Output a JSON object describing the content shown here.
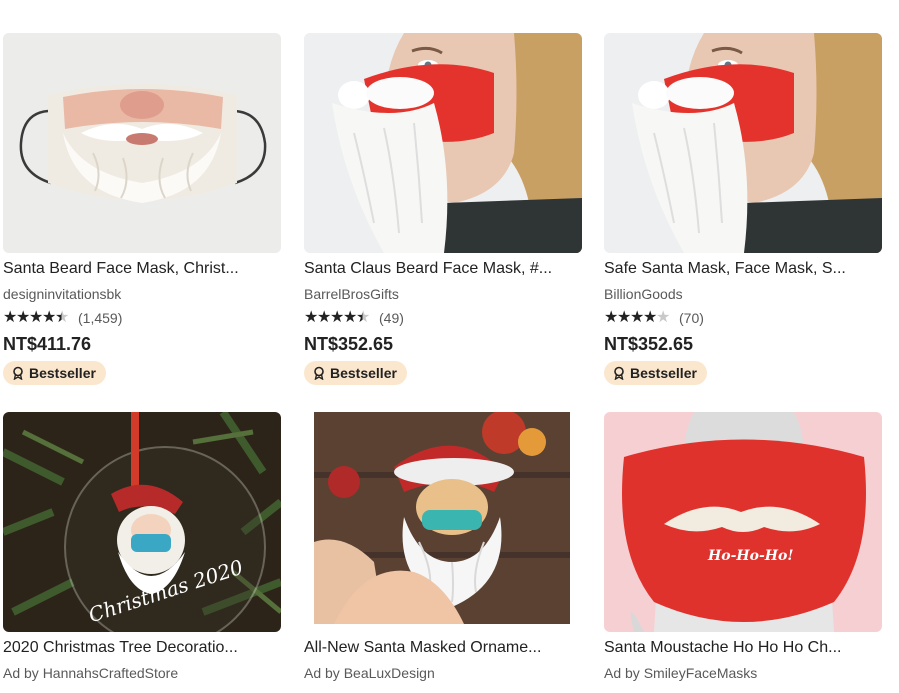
{
  "listings": [
    {
      "title": "Santa Beard Face Mask, Christ...",
      "shop": "designinvitationsbk",
      "stars": [
        1,
        1,
        1,
        1,
        0.5
      ],
      "reviews": "(1,459)",
      "price": "NT$411.76",
      "badge": "Bestseller",
      "image_icon": "santa-beard-mask-image"
    },
    {
      "title": "Santa Claus Beard Face Mask, #...",
      "shop": "BarrelBrosGifts",
      "stars": [
        1,
        1,
        1,
        1,
        0.5
      ],
      "reviews": "(49)",
      "price": "NT$352.65",
      "badge": "Bestseller",
      "image_icon": "red-mask-white-beard-image"
    },
    {
      "title": "Safe Santa Mask, Face Mask, S...",
      "shop": "BillionGoods",
      "stars": [
        1,
        1,
        1,
        1,
        0
      ],
      "reviews": "(70)",
      "price": "NT$352.65",
      "badge": "Bestseller",
      "image_icon": "red-mask-white-beard-image"
    },
    {
      "title": "2020 Christmas Tree Decoratio...",
      "shop": "Ad by HannahsCraftedStore",
      "image_icon": "santa-ornament-image",
      "image_text": "Christmas 2020"
    },
    {
      "title": "All-New Santa Masked Orname...",
      "shop": "Ad by BeaLuxDesign",
      "image_icon": "santa-ornament-hand-image"
    },
    {
      "title": "Santa Moustache Ho Ho Ho Ch...",
      "shop": "Ad by SmileyFaceMasks",
      "image_icon": "red-moustache-mask-image",
      "image_text": "Ho-Ho-Ho!"
    }
  ],
  "colors": {
    "badge_bg": "#fbe7cd",
    "text_primary": "#222222",
    "text_secondary": "#595959",
    "star_empty": "#c9c9c9",
    "mask_red": "#e0322d"
  }
}
